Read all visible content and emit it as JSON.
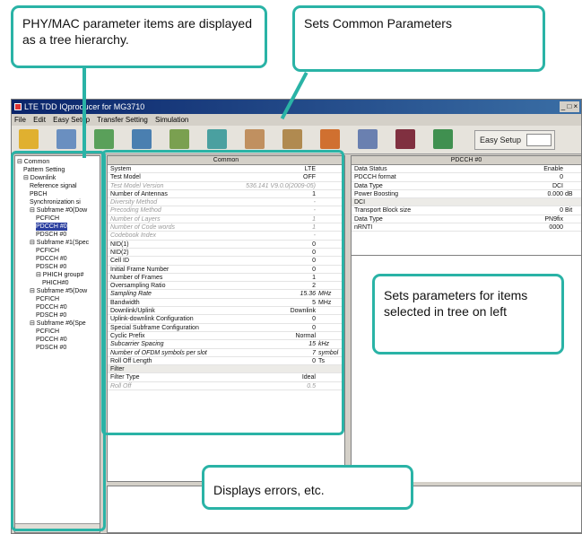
{
  "callouts": {
    "tree": "PHY/MAC parameter items are displayed as a tree hierarchy.",
    "common": "Sets Common Parameters",
    "items": "Sets parameters for items selected in tree on left",
    "errors": "Displays errors, etc."
  },
  "window": {
    "title": "LTE TDD IQproducer for MG3710",
    "controls": "_ □ ×"
  },
  "menu": [
    "File",
    "Edit",
    "Easy Setup",
    "Transfer Setting",
    "Simulation"
  ],
  "toolbar": {
    "easy_setup": "Easy Setup",
    "icons": [
      "open-icon",
      "save-icon",
      "calc-icon",
      "export-icon",
      "graph-icon",
      "ccdf-icon",
      "fft-icon",
      "spectrum-icon",
      "waveform-icon",
      "time-domain-icon",
      "constellation-icon",
      "transfer-icon"
    ]
  },
  "tree": {
    "items": [
      {
        "label": "Common",
        "indent": 0,
        "prefix": "⊟"
      },
      {
        "label": "Pattern Setting",
        "indent": 1,
        "prefix": ""
      },
      {
        "label": "Downlink",
        "indent": 1,
        "prefix": "⊟"
      },
      {
        "label": "Reference signal",
        "indent": 2,
        "prefix": ""
      },
      {
        "label": "PBCH",
        "indent": 2,
        "prefix": ""
      },
      {
        "label": "Synchronization si",
        "indent": 2,
        "prefix": ""
      },
      {
        "label": "Subframe #0(Dow",
        "indent": 2,
        "prefix": "⊟"
      },
      {
        "label": "PCFICH",
        "indent": 3,
        "prefix": ""
      },
      {
        "label": "PDCCH #0",
        "indent": 3,
        "prefix": "",
        "selected": true
      },
      {
        "label": "PDSCH #0",
        "indent": 3,
        "prefix": ""
      },
      {
        "label": "Subframe #1(Spec",
        "indent": 2,
        "prefix": "⊟"
      },
      {
        "label": "PCFICH",
        "indent": 3,
        "prefix": ""
      },
      {
        "label": "PDCCH #0",
        "indent": 3,
        "prefix": ""
      },
      {
        "label": "PDSCH #0",
        "indent": 3,
        "prefix": ""
      },
      {
        "label": "PHICH group#",
        "indent": 3,
        "prefix": "⊟"
      },
      {
        "label": "PHICH#0",
        "indent": 4,
        "prefix": ""
      },
      {
        "label": "Subframe #5(Dow",
        "indent": 2,
        "prefix": "⊟"
      },
      {
        "label": "PCFICH",
        "indent": 3,
        "prefix": ""
      },
      {
        "label": "PDCCH #0",
        "indent": 3,
        "prefix": ""
      },
      {
        "label": "PDSCH #0",
        "indent": 3,
        "prefix": ""
      },
      {
        "label": "Subframe #6(Spe",
        "indent": 2,
        "prefix": "⊟"
      },
      {
        "label": "PCFICH",
        "indent": 3,
        "prefix": ""
      },
      {
        "label": "PDCCH #0",
        "indent": 3,
        "prefix": ""
      },
      {
        "label": "PDSCH #0",
        "indent": 3,
        "prefix": ""
      }
    ]
  },
  "common_table": {
    "header": "Common",
    "rows": [
      {
        "label": "System",
        "value": "LTE",
        "unit": "",
        "style": ""
      },
      {
        "label": "Test Model",
        "value": "OFF",
        "unit": "",
        "style": ""
      },
      {
        "label": "Test Model Version",
        "value": "536.141 V9.0.0(2009-05)",
        "unit": "",
        "style": "dim"
      },
      {
        "label": "Number of Antennas",
        "value": "1",
        "unit": "",
        "style": ""
      },
      {
        "label": "Diversity Method",
        "value": "-",
        "unit": "",
        "style": "dim"
      },
      {
        "label": "Precoding Method",
        "value": "-",
        "unit": "",
        "style": "dim"
      },
      {
        "label": "Number of Layers",
        "value": "1",
        "unit": "",
        "style": "dim"
      },
      {
        "label": "Number of Code words",
        "value": "1",
        "unit": "",
        "style": "dim"
      },
      {
        "label": "Codebook Index",
        "value": "-",
        "unit": "",
        "style": "dim"
      },
      {
        "label": "NID(1)",
        "value": "0",
        "unit": "",
        "style": ""
      },
      {
        "label": "NID(2)",
        "value": "0",
        "unit": "",
        "style": ""
      },
      {
        "label": "Cell ID",
        "value": "0",
        "unit": "",
        "style": ""
      },
      {
        "label": "Initial Frame Number",
        "value": "0",
        "unit": "",
        "style": ""
      },
      {
        "label": "Number of Frames",
        "value": "1",
        "unit": "",
        "style": ""
      },
      {
        "label": "Oversampling Ratio",
        "value": "2",
        "unit": "",
        "style": ""
      },
      {
        "label": "Sampling Rate",
        "value": "15.36",
        "unit": "MHz",
        "style": "it"
      },
      {
        "label": "Bandwidth",
        "value": "5",
        "unit": "MHz",
        "style": ""
      },
      {
        "label": "Downlink/Uplink",
        "value": "Downlink",
        "unit": "",
        "style": ""
      },
      {
        "label": "Uplink-downlink Configuration",
        "value": "0",
        "unit": "",
        "style": ""
      },
      {
        "label": "Special Subframe Configuration",
        "value": "0",
        "unit": "",
        "style": ""
      },
      {
        "label": "Cyclic Prefix",
        "value": "Normal",
        "unit": "",
        "style": ""
      },
      {
        "label": "Subcarrier Spacing",
        "value": "15",
        "unit": "kHz",
        "style": "it"
      },
      {
        "label": "Number of OFDM symbols per slot",
        "value": "7",
        "unit": "symbol",
        "style": "it"
      },
      {
        "label": "Roll Off Length",
        "value": "0",
        "unit": "Ts",
        "style": ""
      },
      {
        "label": "Filter",
        "value": "",
        "unit": "",
        "style": "sec"
      },
      {
        "label": "Filter Type",
        "value": "Ideal",
        "unit": "",
        "style": ""
      },
      {
        "label": "Roll Off",
        "value": "0.5",
        "unit": "",
        "style": "dim"
      }
    ]
  },
  "pdcch_table": {
    "header": "PDCCH #0",
    "rows": [
      {
        "label": "Data Status",
        "value": "Enable",
        "unit": "",
        "style": ""
      },
      {
        "label": "PDCCH format",
        "value": "0",
        "unit": "",
        "style": ""
      },
      {
        "label": "Data Type",
        "value": "DCI",
        "unit": "",
        "style": ""
      },
      {
        "label": "Power Boosting",
        "value": "0.000",
        "unit": "dB",
        "style": ""
      },
      {
        "label": "DCI",
        "value": "",
        "unit": "",
        "style": "sec"
      },
      {
        "label": "Transport Block size",
        "value": "0",
        "unit": "Bit",
        "style": ""
      },
      {
        "label": "Data Type",
        "value": "PN9fix",
        "unit": "",
        "style": ""
      },
      {
        "label": "nRNTI",
        "value": "0000",
        "unit": "",
        "style": ""
      }
    ]
  },
  "colors": {
    "callout_border": "#2ab3a6",
    "title_bar": "#0a246a",
    "selection": "#2b3fa0"
  }
}
